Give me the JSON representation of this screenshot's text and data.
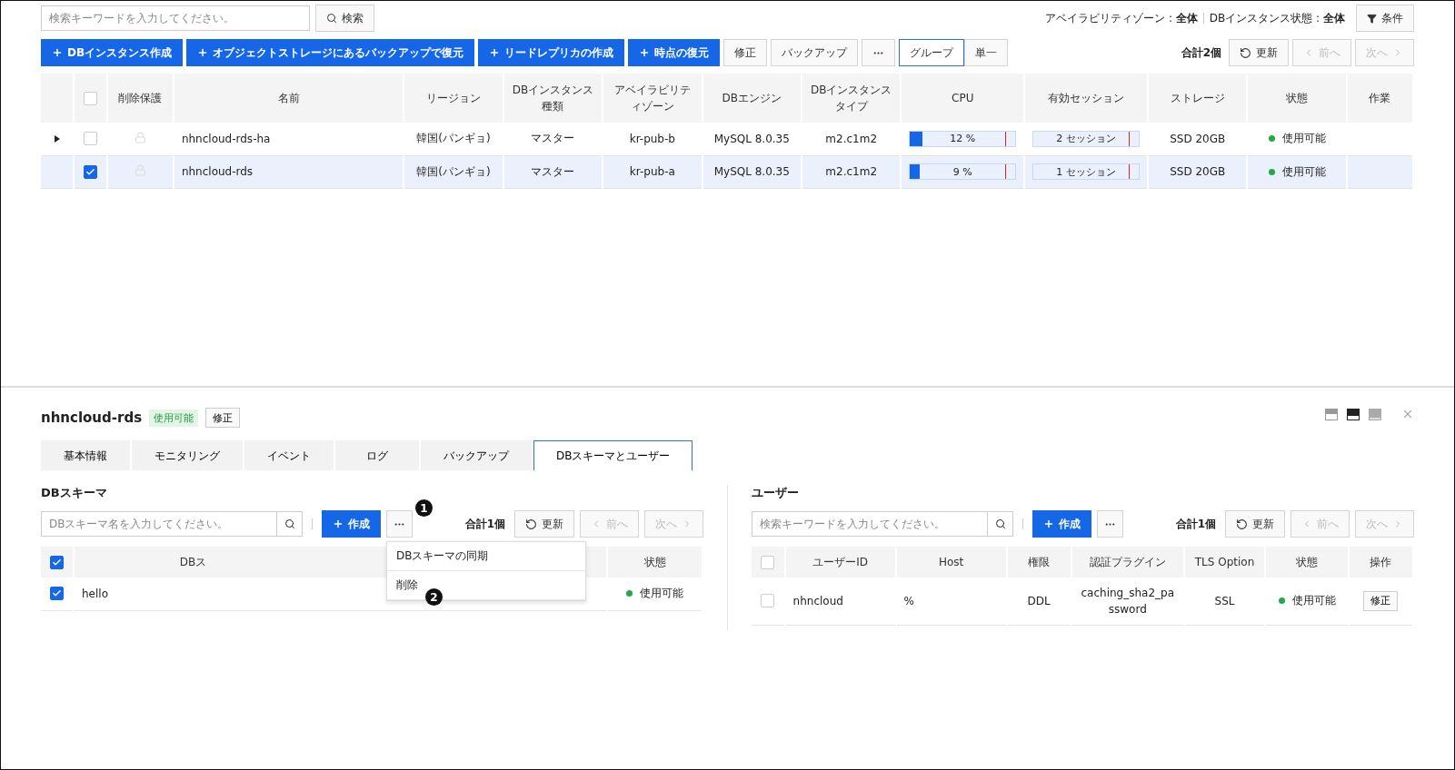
{
  "top": {
    "search": {
      "placeholder": "検索キーワードを入力してください。",
      "button": "検索"
    },
    "filters": [
      {
        "label": "アベイラビリティゾーン :",
        "value": "全体"
      },
      {
        "label": "DBインスタンス状態 :",
        "value": "全体"
      }
    ],
    "conditions_button": "条件",
    "actions": [
      {
        "label": "DBインスタンス作成",
        "kind": "primary"
      },
      {
        "label": "オブジェクトストレージにあるバックアップで復元",
        "kind": "primary"
      },
      {
        "label": "リードレプリカの作成",
        "kind": "primary"
      },
      {
        "label": "時点の復元",
        "kind": "primary"
      },
      {
        "label": "修正",
        "kind": "default"
      },
      {
        "label": "バックアップ",
        "kind": "default"
      },
      {
        "kind": "more"
      }
    ],
    "view_toggle": [
      {
        "label": "グループ",
        "selected": true
      },
      {
        "label": "単一",
        "selected": false
      }
    ],
    "total": "合計2個",
    "refresh": "更新",
    "prev": {
      "label": "前へ",
      "disabled": true
    },
    "next": {
      "label": "次へ",
      "disabled": true
    },
    "table": {
      "header_checkbox": {
        "checked": false
      },
      "columns": [
        "削除保護",
        "名前",
        "リージョン",
        "DBインスタンス種類",
        "アベイラビリティゾーン",
        "DBエンジン",
        "DBインスタンスタイプ",
        "CPU",
        "有効セッション",
        "ストレージ",
        "状態",
        "作業"
      ],
      "rows": [
        {
          "expandable": true,
          "checked": false,
          "selected": false,
          "name": "nhncloud-rds-ha",
          "region": "韓国(パンギョ)",
          "kind": "マスター",
          "az": "kr-pub-b",
          "engine": "MySQL 8.0.35",
          "type": "m2.c1m2",
          "cpu": {
            "level": 0.12,
            "text": "12 %"
          },
          "sessions": "2 セッション",
          "storage": "SSD 20GB",
          "status": "使用可能"
        },
        {
          "expandable": false,
          "checked": true,
          "selected": true,
          "name": "nhncloud-rds",
          "region": "韓国(パンギョ)",
          "kind": "マスター",
          "az": "kr-pub-a",
          "engine": "MySQL 8.0.35",
          "type": "m2.c1m2",
          "cpu": {
            "level": 0.09,
            "text": "9 %"
          },
          "sessions": "1 セッション",
          "storage": "SSD 20GB",
          "status": "使用可能"
        }
      ]
    }
  },
  "detail": {
    "title": "nhncloud-rds",
    "status_badge": "使用可能",
    "edit_button": "修正",
    "tabs": [
      {
        "label": "基本情報",
        "selected": false
      },
      {
        "label": "モニタリング",
        "selected": false
      },
      {
        "label": "イベント",
        "selected": false
      },
      {
        "label": "ログ",
        "selected": false
      },
      {
        "label": "バックアップ",
        "selected": false
      },
      {
        "label": "DBスキーマとユーザー",
        "selected": true
      }
    ],
    "schema": {
      "heading": "DBスキーマ",
      "placeholder": "DBスキーマ名を入力してください。",
      "create": "作成",
      "callout": "1",
      "total": "合計1個",
      "refresh": "更新",
      "prev": {
        "label": "前へ",
        "disabled": true
      },
      "next": {
        "label": "次へ",
        "disabled": true
      },
      "menu": {
        "items": [
          "DBスキーマの同期",
          "削除"
        ],
        "callout": "2"
      },
      "header_checkbox": {
        "checked": true
      },
      "columns": [
        "DBス",
        "状態"
      ],
      "rows": [
        {
          "checked": true,
          "name": "hello",
          "status": "使用可能"
        }
      ]
    },
    "users": {
      "heading": "ユーザー",
      "placeholder": "検索キーワードを入力してください。",
      "create": "作成",
      "total": "合計1個",
      "refresh": "更新",
      "prev": {
        "label": "前へ",
        "disabled": true
      },
      "next": {
        "label": "次へ",
        "disabled": true
      },
      "header_checkbox": {
        "checked": false
      },
      "columns": [
        "ユーザーID",
        "Host",
        "権限",
        "認証プラグイン",
        "TLS Option",
        "状態",
        "操作"
      ],
      "rows": [
        {
          "checked": false,
          "user_id": "nhncloud",
          "host": "%",
          "privilege": "DDL",
          "plugin": "caching_sha2_password",
          "tls": "SSL",
          "status": "使用可能",
          "action": "修正"
        }
      ]
    }
  }
}
